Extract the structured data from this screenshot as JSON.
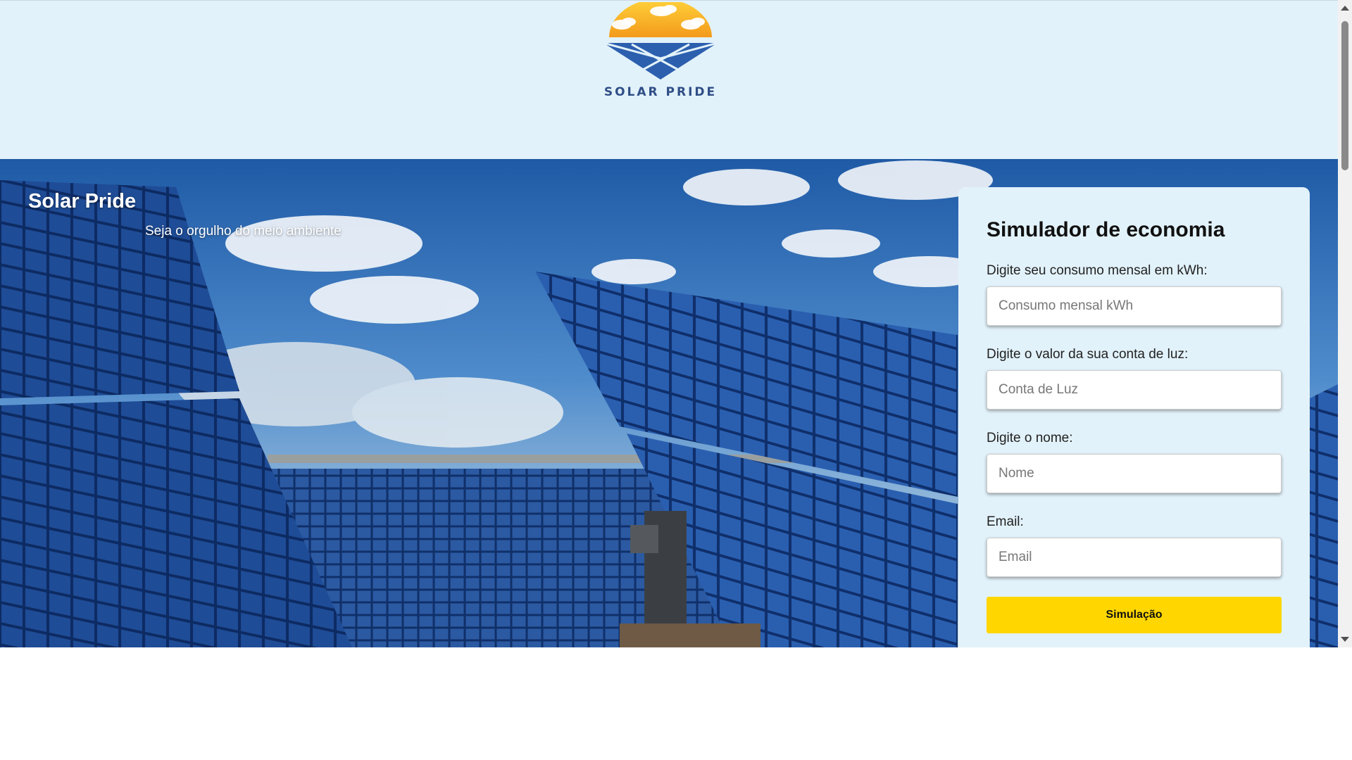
{
  "header": {
    "logo_text": "SOLAR PRIDE"
  },
  "hero": {
    "title": "Solar Pride",
    "subtitle": "Seja o orgulho do meio ambiente"
  },
  "simulator": {
    "title": "Simulador de economia",
    "consumption_label": "Digite seu consumo mensal em kWh:",
    "consumption_placeholder": "Consumo mensal kWh",
    "bill_label": "Digite o valor da sua conta de luz:",
    "bill_placeholder": "Conta de Luz",
    "name_label": "Digite o nome:",
    "name_placeholder": "Nome",
    "email_label": "Email:",
    "email_placeholder": "Email",
    "submit_label": "Simulação"
  },
  "colors": {
    "header_bg": "#e2f2fa",
    "card_bg": "#e2f2fa",
    "button_bg": "#ffd600",
    "logo_blue": "#2f4e86",
    "sky_blue": "#2f6db5"
  }
}
